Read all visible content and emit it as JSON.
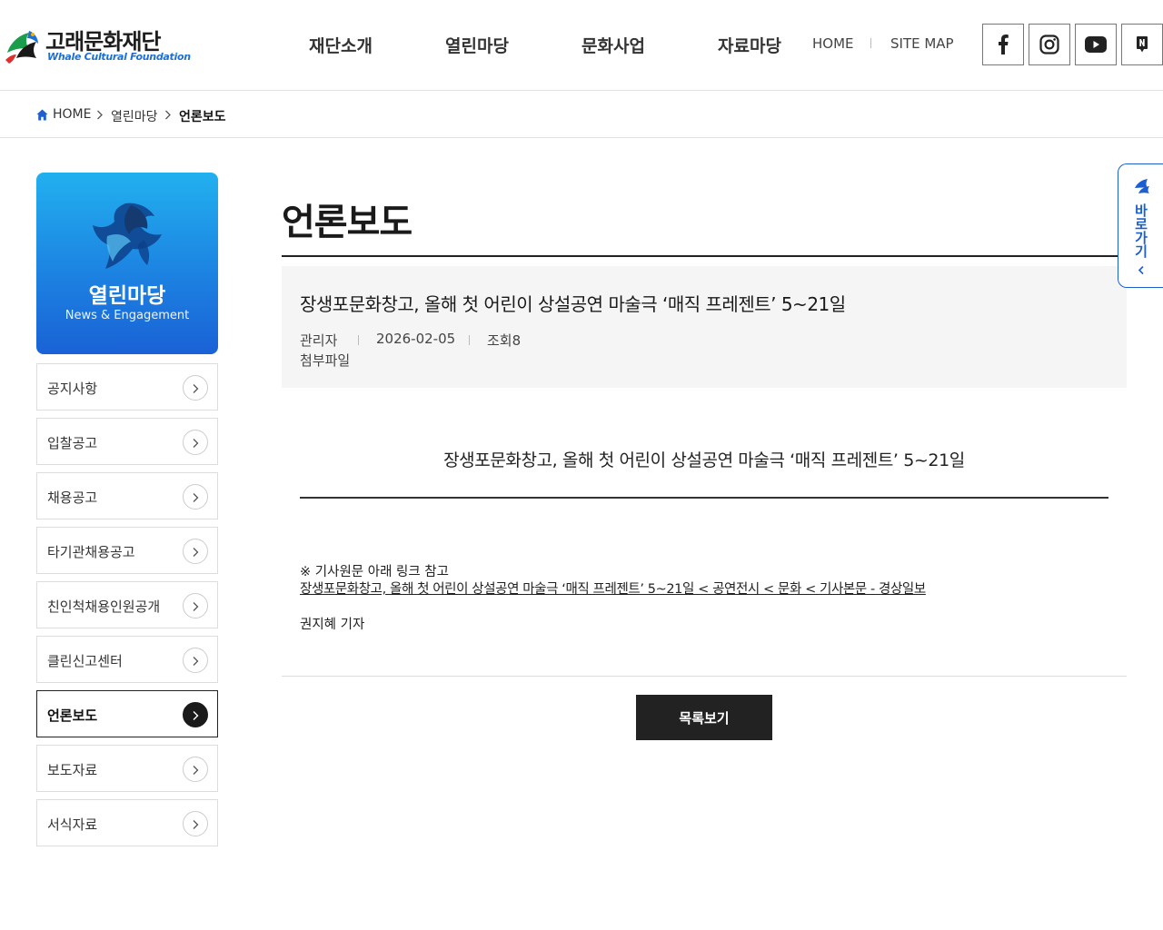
{
  "brand": {
    "name_ko": "고래문화재단",
    "name_en": "Whale Cultural Foundation"
  },
  "gnb": [
    {
      "label": "재단소개"
    },
    {
      "label": "열린마당"
    },
    {
      "label": "문화사업"
    },
    {
      "label": "자료마당"
    }
  ],
  "util": {
    "home": "HOME",
    "sitemap": "SITE MAP"
  },
  "sns": [
    {
      "icon": "facebook-icon"
    },
    {
      "icon": "instagram-icon"
    },
    {
      "icon": "youtube-icon"
    },
    {
      "icon": "naver-blog-icon"
    }
  ],
  "breadcrumb": {
    "home": "HOME",
    "section": "열린마당",
    "current": "언론보도"
  },
  "sidebar": {
    "title": "열린마당",
    "subtitle": "News & Engagement",
    "items": [
      {
        "label": "공지사항"
      },
      {
        "label": "입찰공고"
      },
      {
        "label": "채용공고"
      },
      {
        "label": "타기관채용공고"
      },
      {
        "label": "친인척채용인원공개"
      },
      {
        "label": "클린신고센터"
      },
      {
        "label": "언론보도",
        "active": true
      },
      {
        "label": "보도자료"
      },
      {
        "label": "서식자료"
      }
    ]
  },
  "page": {
    "title": "언론보도"
  },
  "post": {
    "title": "장생포문화창고, 올해 첫 어린이 상설공연 마술극 ‘매직 프레젠트’ 5~21일",
    "author": "관리자",
    "date": "2026-02-05",
    "views": "조회8",
    "attachment_label": "첨부파일",
    "headline": "장생포문화창고, 올해 첫 어린이 상설공연 마술극 ‘매직 프레젠트’ 5~21일",
    "note": "※ 기사원문 아래 링크 참고",
    "link_text": "장생포문화창고, 올해 첫 어린이 상설공연 마술극 ‘매직 프레젠트’ 5~21일 < 공연전시 < 문화 < 기사본문 - 경상일보",
    "reporter": "권지혜 기자"
  },
  "actions": {
    "list_button": "목록보기"
  },
  "quick": {
    "label": "바로가기"
  },
  "colors": {
    "accent_blue": "#1d5fcf",
    "banner_top": "#22b0ef",
    "banner_bottom": "#1a62d6",
    "dark": "#222222"
  }
}
